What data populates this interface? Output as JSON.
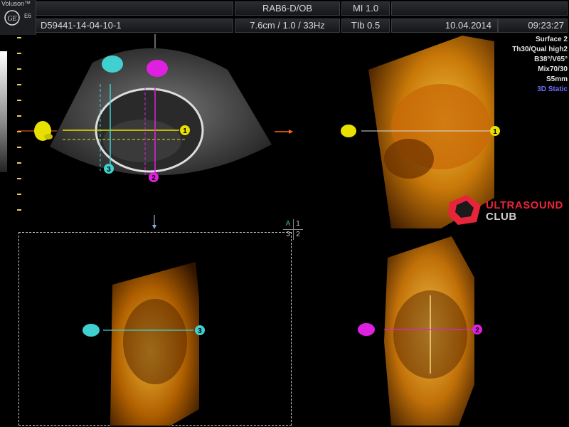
{
  "header": {
    "brand": "Voluson™",
    "model": "E6",
    "probe_preset": "RAB6-D/OB",
    "mi": "MI  1.0",
    "patient_id": "D59441-14-04-10-1",
    "scan_params": "7.6cm / 1.0 / 33Hz",
    "tib": "TIb  0.5",
    "date": "10.04.2014",
    "time": "09:23:27"
  },
  "render_info": {
    "mode": "Surface 2",
    "threshold_quality": "Th30/Qual high2",
    "angles": "B38°/V65°",
    "mix": "Mix70/30",
    "slice": "S5mm",
    "static_mode": "3D Static"
  },
  "planes": {
    "marker_1": "1",
    "marker_2": "2",
    "marker_3": "3",
    "grid_A": "A",
    "grid_1": "1",
    "grid_3": "3",
    "grid_2": "2"
  },
  "watermark": {
    "line1": "ULTRASOUND",
    "line2": "CLUB"
  },
  "colors": {
    "plane_1": "#e8e000",
    "plane_2": "#e020e0",
    "plane_3": "#40d0d0",
    "accent_orange": "#ff6a20",
    "brand_red": "#e8243a",
    "info_blue": "#6f6dff"
  },
  "icons": [
    "ge-logo-icon",
    "fetal-head-icon-yellow",
    "fetal-head-icon-cyan",
    "fetal-head-icon-magenta",
    "orientation-arrow-icon"
  ]
}
